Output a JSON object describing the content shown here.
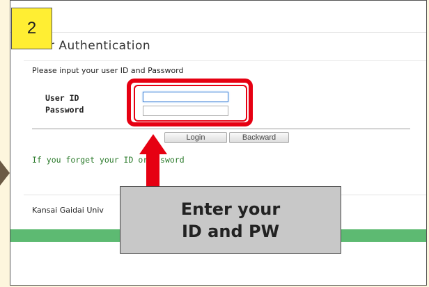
{
  "step": {
    "number": "2"
  },
  "page": {
    "title": "er Authentication",
    "instruction": "Please input your user ID and Password"
  },
  "form": {
    "userid_label": "User ID",
    "password_label": "Password",
    "userid_value": "",
    "password_value": ""
  },
  "buttons": {
    "login": "Login",
    "backward": "Backward"
  },
  "links": {
    "forgot": "If you forget your ID or p",
    "forgot_tail": "sword"
  },
  "footer": {
    "text": "Kansai Gaidai Univ"
  },
  "callout": {
    "line1": "Enter your",
    "line2": "ID and PW"
  },
  "colors": {
    "highlight": "#e60012",
    "badge": "#ffee33",
    "green_bar": "#5dba72",
    "link": "#2a7a2a",
    "background": "#fdf6dd"
  }
}
